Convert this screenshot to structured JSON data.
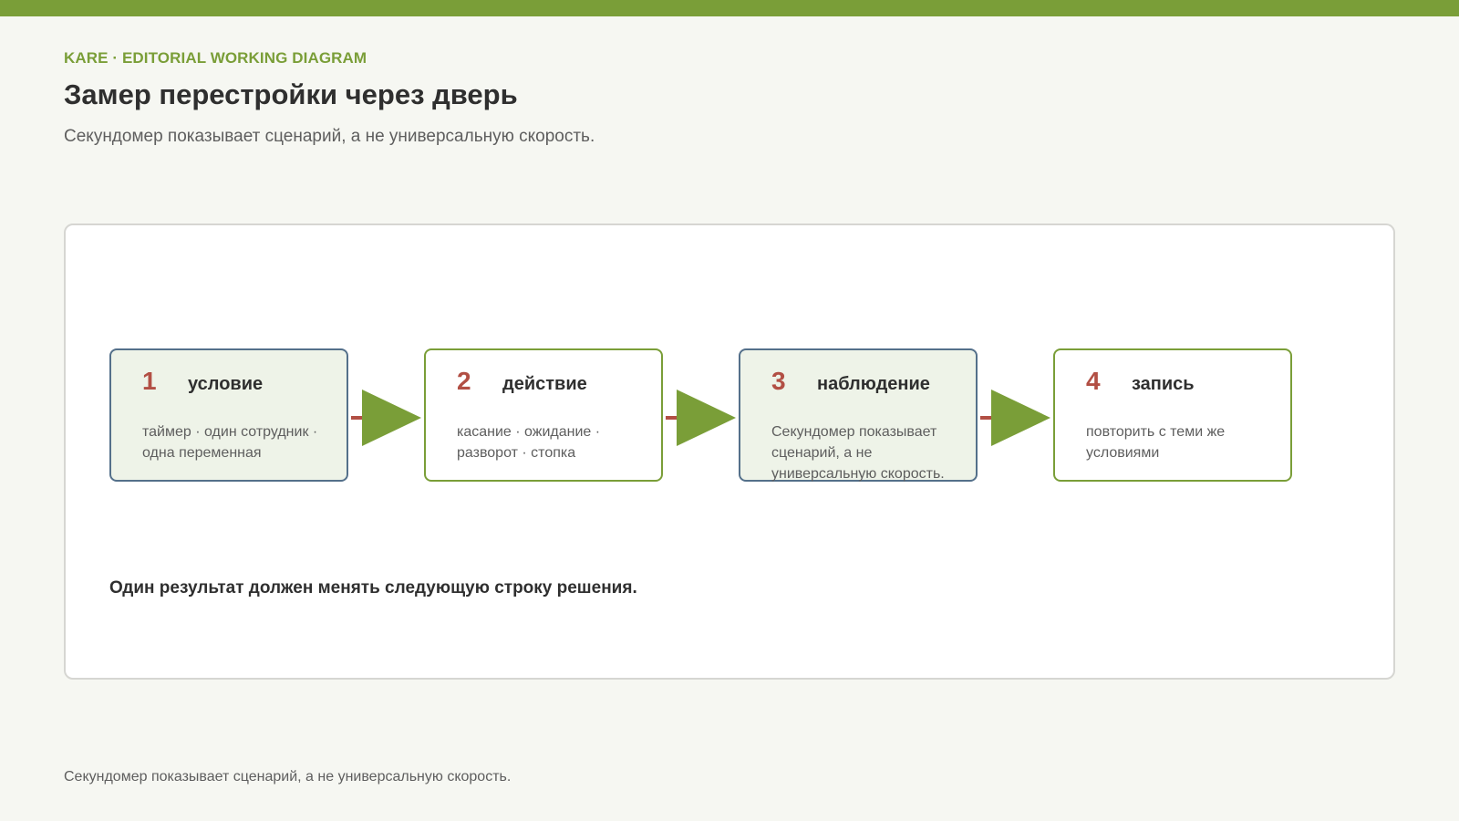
{
  "header": {
    "kicker": "KARE · EDITORIAL WORKING DIAGRAM",
    "title": "Замер перестройки через дверь",
    "subtitle": "Секундомер показывает сценарий, а не универсальную скорость."
  },
  "diagram": {
    "steps": [
      {
        "number": "1",
        "title": "условие",
        "description": "таймер · один сотрудник · одна переменная",
        "style": "blue"
      },
      {
        "number": "2",
        "title": "действие",
        "description": "касание · ожидание · разворот · стопка",
        "style": "green"
      },
      {
        "number": "3",
        "title": "наблюдение",
        "description": "Секундомер показывает сценарий, а не универсальную скорость.",
        "style": "blue"
      },
      {
        "number": "4",
        "title": "запись",
        "description": "повторить с теми же условиями",
        "style": "green"
      }
    ],
    "note": "Один результат должен менять следующую строку решения."
  },
  "footer": {
    "text": "Секундомер показывает сценарий, а не универсальную скорость."
  },
  "colors": {
    "accent": "#7a9e38",
    "number": "#b24f44",
    "blue_border": "#54708a",
    "card_fill": "#eef3e8",
    "background": "#f6f7f2"
  }
}
